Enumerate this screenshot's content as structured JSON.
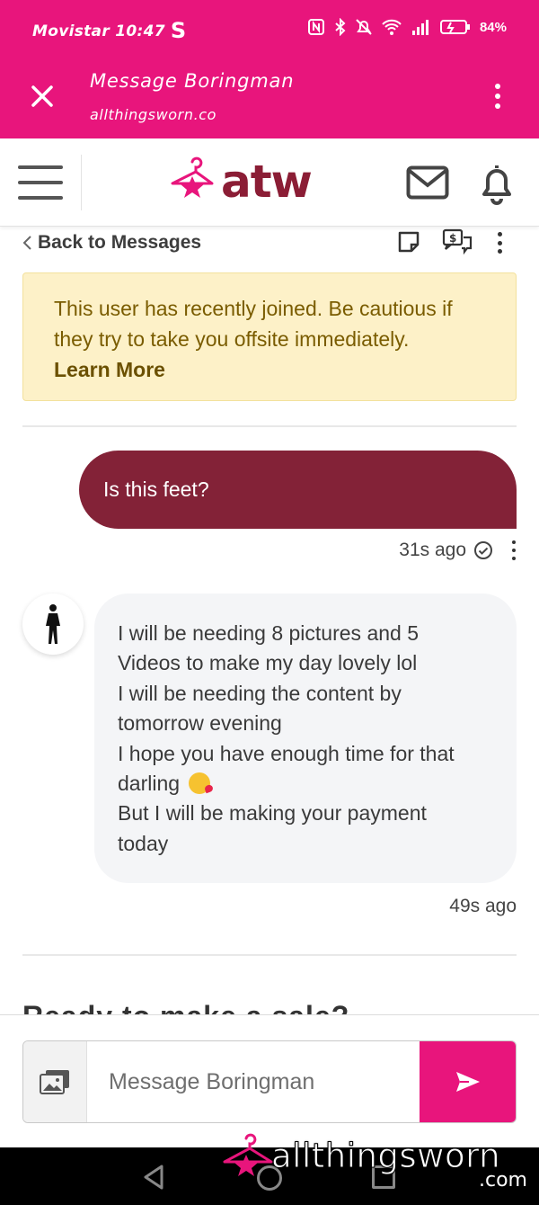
{
  "status_bar": {
    "carrier_time": "Movistar 10:47",
    "extra_glyph": "S",
    "battery": "84%"
  },
  "tab": {
    "title": "Message Boringman",
    "url": "allthingsworn.co"
  },
  "site": {
    "logo_text": "atw",
    "brand_color": "#8b1d35",
    "accent_color": "#e8157c"
  },
  "thread": {
    "back_label": "Back to Messages",
    "warning_text": "This user has recently joined. Be cautious if they try to take you offsite immediately.",
    "warning_link": "Learn More",
    "messages": [
      {
        "direction": "outgoing",
        "text": "Is this feet?",
        "time": "31s ago",
        "status_icon": "check-circle-icon"
      },
      {
        "direction": "incoming",
        "lines": [
          "I will be needing 8 pictures and 5",
          "Videos to make my day lovely lol",
          "I will be needing the content by",
          "tomorrow evening",
          "I hope you have enough time for that",
          "darling",
          "But I will be making your payment",
          "today"
        ],
        "emoji": "kissing-face-icon",
        "time": "49s ago"
      }
    ],
    "partial_heading": "Ready to make a sale?"
  },
  "composer": {
    "placeholder": "Message Boringman"
  },
  "watermark": {
    "text": "allthingsworn",
    "suffix": ".com"
  }
}
